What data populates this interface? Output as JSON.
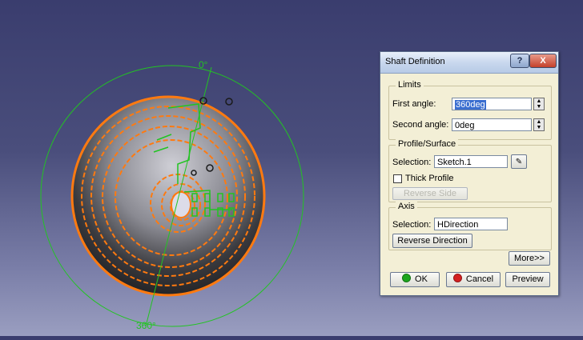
{
  "viewport": {
    "top_angle_label": "0°",
    "bottom_angle_label": "360°",
    "colors": {
      "part_orange": "#ff7a10",
      "axis_green": "#22c422",
      "background": "#3a3d6e"
    }
  },
  "dialog": {
    "title": "Shaft Definition",
    "help_label": "?",
    "close_label": "X",
    "limits": {
      "group_label": "Limits",
      "first_angle_label": "First angle:",
      "first_angle_value": "360deg",
      "second_angle_label": "Second angle:",
      "second_angle_value": "0deg"
    },
    "profile": {
      "group_label": "Profile/Surface",
      "selection_label": "Selection:",
      "selection_value": "Sketch.1",
      "thick_profile_label": "Thick Profile",
      "thick_profile_checked": false,
      "reverse_side_label": "Reverse Side"
    },
    "axis": {
      "group_label": "Axis",
      "selection_label": "Selection:",
      "selection_value": "HDirection",
      "reverse_direction_label": "Reverse Direction"
    },
    "more_label": "More>>",
    "ok_label": "OK",
    "cancel_label": "Cancel",
    "preview_label": "Preview",
    "ok_color": "#1ca51c",
    "cancel_color": "#d42020"
  }
}
